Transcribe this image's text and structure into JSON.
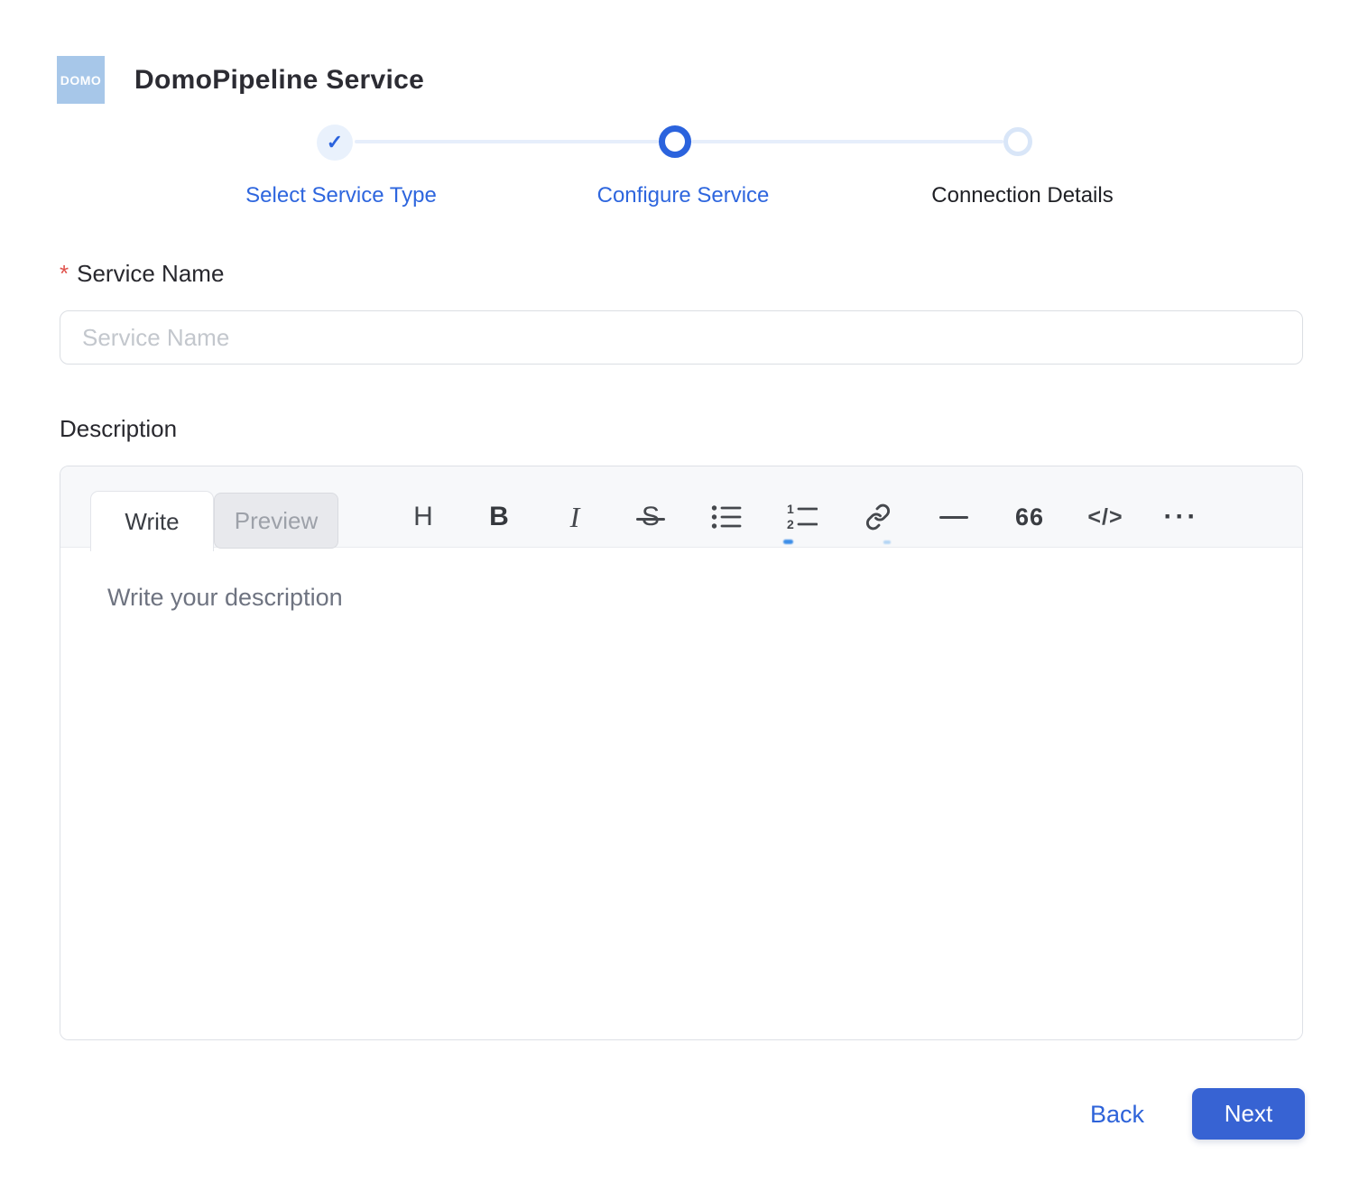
{
  "app": {
    "logo_text": "DOMO",
    "title": "DomoPipeline Service"
  },
  "stepper": {
    "steps": [
      {
        "label": "Select Service Type",
        "state": "completed",
        "icon": "✓"
      },
      {
        "label": "Configure Service",
        "state": "current"
      },
      {
        "label": "Connection Details",
        "state": "upcoming"
      }
    ]
  },
  "form": {
    "service_name": {
      "required_marker": "*",
      "label": "Service Name",
      "placeholder": "Service Name",
      "value": ""
    },
    "description": {
      "label": "Description",
      "placeholder": "Write your description",
      "value": ""
    }
  },
  "editor": {
    "tabs": [
      {
        "label": "Write",
        "active": true
      },
      {
        "label": "Preview",
        "active": false
      }
    ],
    "toolbar": [
      {
        "name": "heading-icon",
        "glyph": "H"
      },
      {
        "name": "bold-icon",
        "glyph": "B"
      },
      {
        "name": "italic-icon",
        "glyph": "I"
      },
      {
        "name": "strikethrough-icon",
        "glyph": "S"
      },
      {
        "name": "bullet-list-icon"
      },
      {
        "name": "ordered-list-icon"
      },
      {
        "name": "link-icon"
      },
      {
        "name": "horizontal-rule-icon",
        "glyph": "—"
      },
      {
        "name": "quote-icon",
        "glyph": "66"
      },
      {
        "name": "code-icon",
        "glyph": "</>"
      },
      {
        "name": "more-icon",
        "glyph": "···"
      }
    ]
  },
  "footer": {
    "back_label": "Back",
    "next_label": "Next"
  },
  "colors": {
    "accent_blue": "#2b63dd",
    "step_label_blue": "#2e66de",
    "button_blue": "#3763d3",
    "logo_blue": "#a7c7e9",
    "required_red": "#e0524c",
    "connector_blue": "#e6eefb",
    "upcoming_ring": "#d9e6f8",
    "toolbar_bg": "#f7f8fa"
  }
}
